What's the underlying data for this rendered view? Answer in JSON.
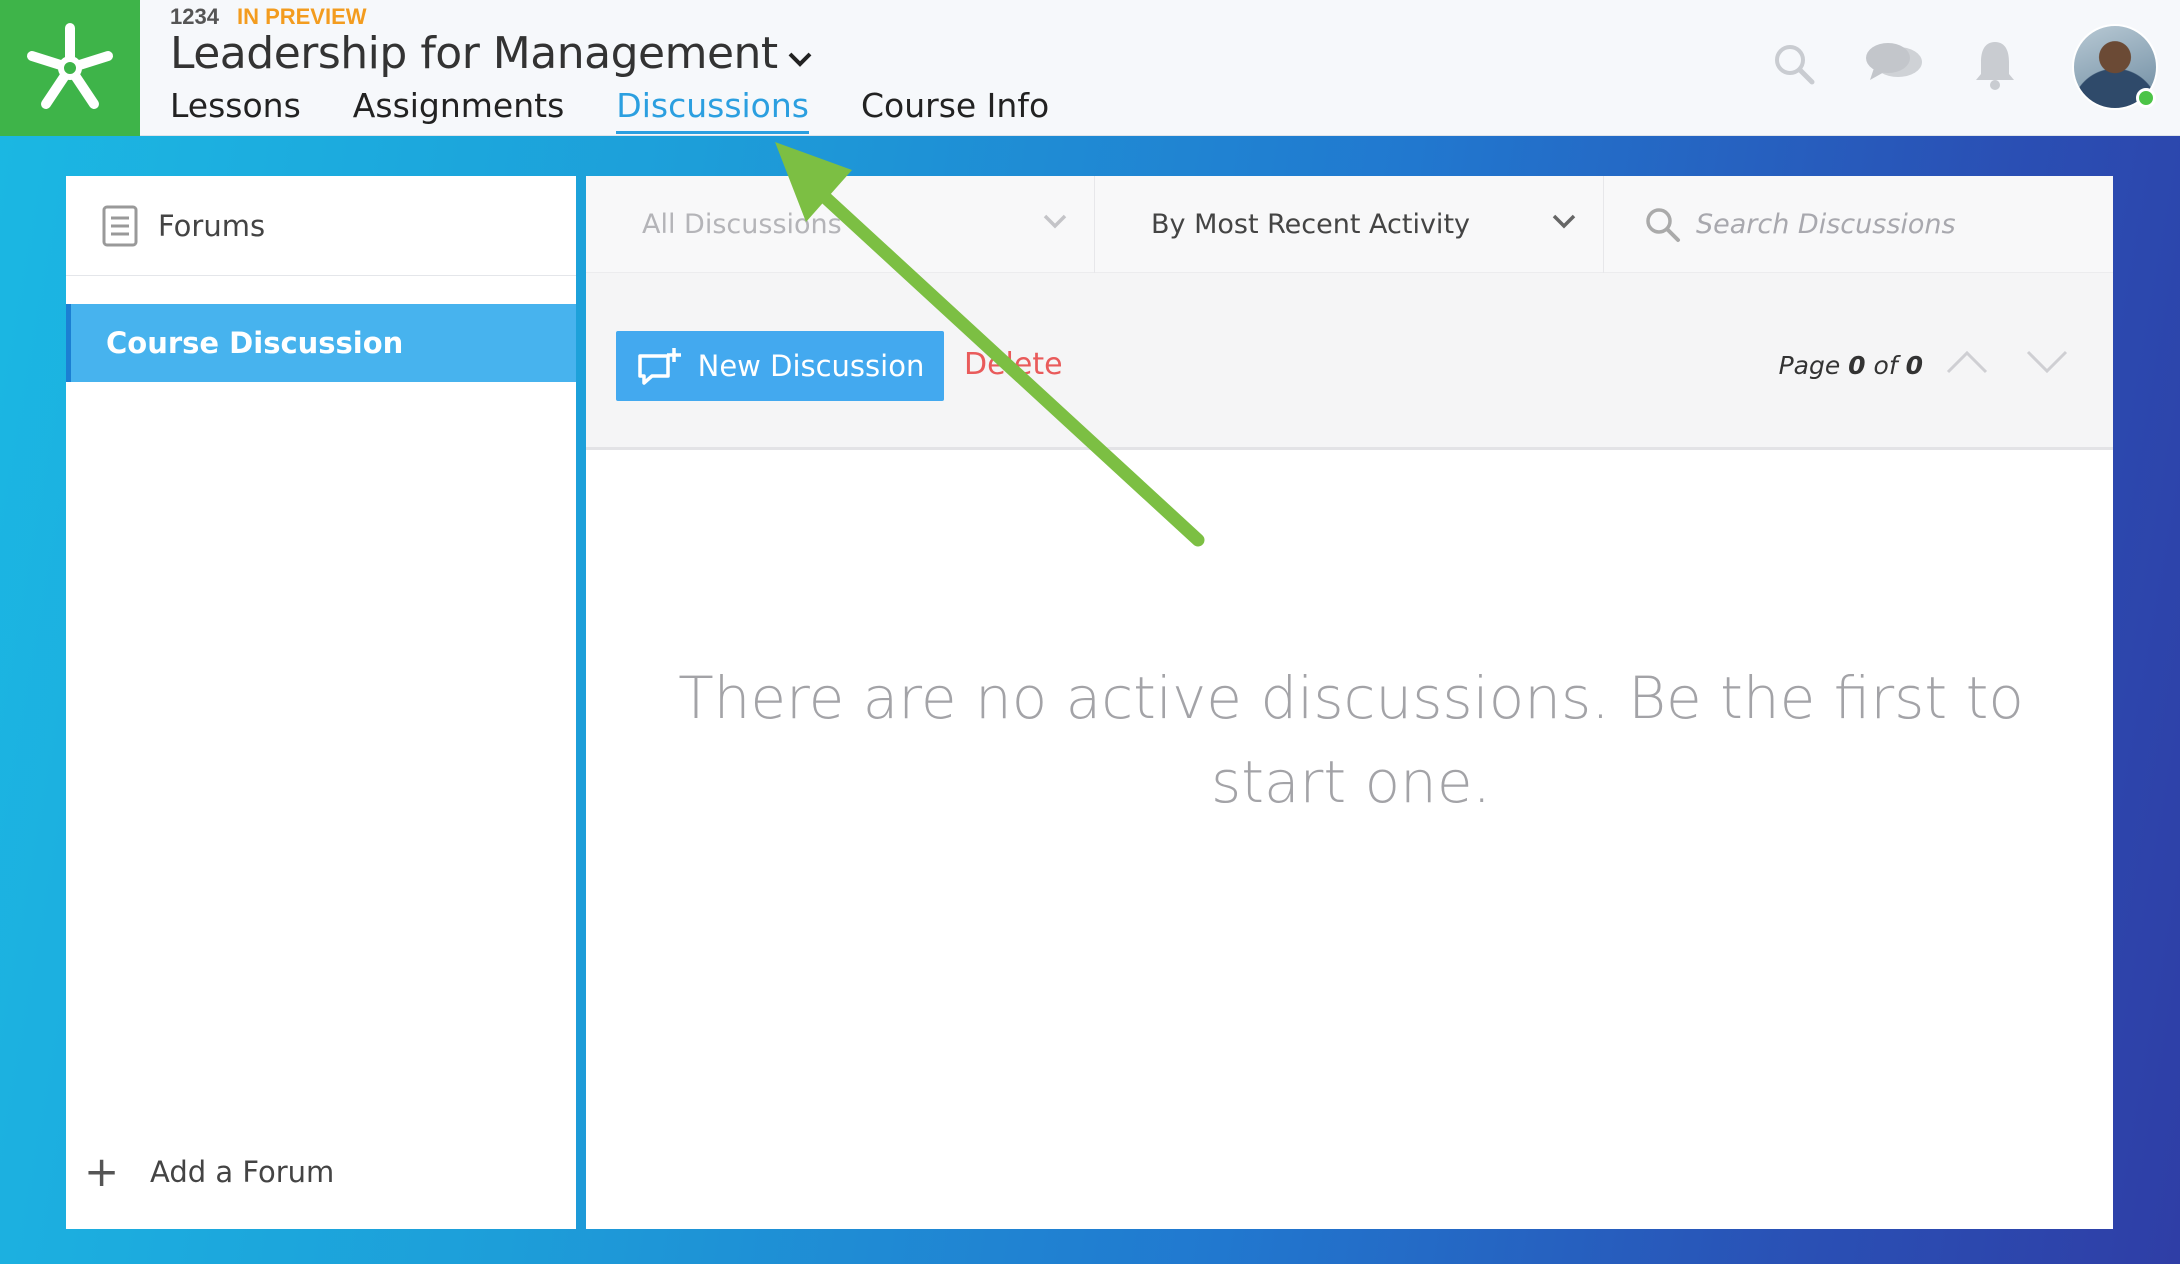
{
  "header": {
    "course_number": "1234",
    "status_badge": "IN PREVIEW",
    "course_title": "Leadership for Management",
    "tabs": [
      {
        "label": "Lessons",
        "active": false
      },
      {
        "label": "Assignments",
        "active": false
      },
      {
        "label": "Discussions",
        "active": true
      },
      {
        "label": "Course Info",
        "active": false
      }
    ],
    "icons": [
      "search-icon",
      "chat-icon",
      "bell-icon"
    ],
    "avatar_status": "online"
  },
  "sidebar": {
    "title": "Forums",
    "forums": [
      {
        "label": "Course Discussion",
        "selected": true
      }
    ],
    "add_label": "Add a Forum"
  },
  "main": {
    "filter_label": "All Discussions",
    "sort_label": "By Most Recent Activity",
    "search": {
      "placeholder": "Search Discussions"
    },
    "new_button_label": "New Discussion",
    "delete_label": "Delete",
    "pager": {
      "prefix": "Page",
      "current": "0",
      "middle": "of",
      "total": "0"
    },
    "empty_message": "There are no active discussions. Be the first to start one."
  },
  "colors": {
    "brand_green": "#3eb449",
    "accent_blue": "#43a9ef",
    "active_tab": "#2b9fe0",
    "preview_orange": "#f39c1f",
    "delete_red": "#e95b5b",
    "annotation_arrow": "#7cbf43"
  }
}
